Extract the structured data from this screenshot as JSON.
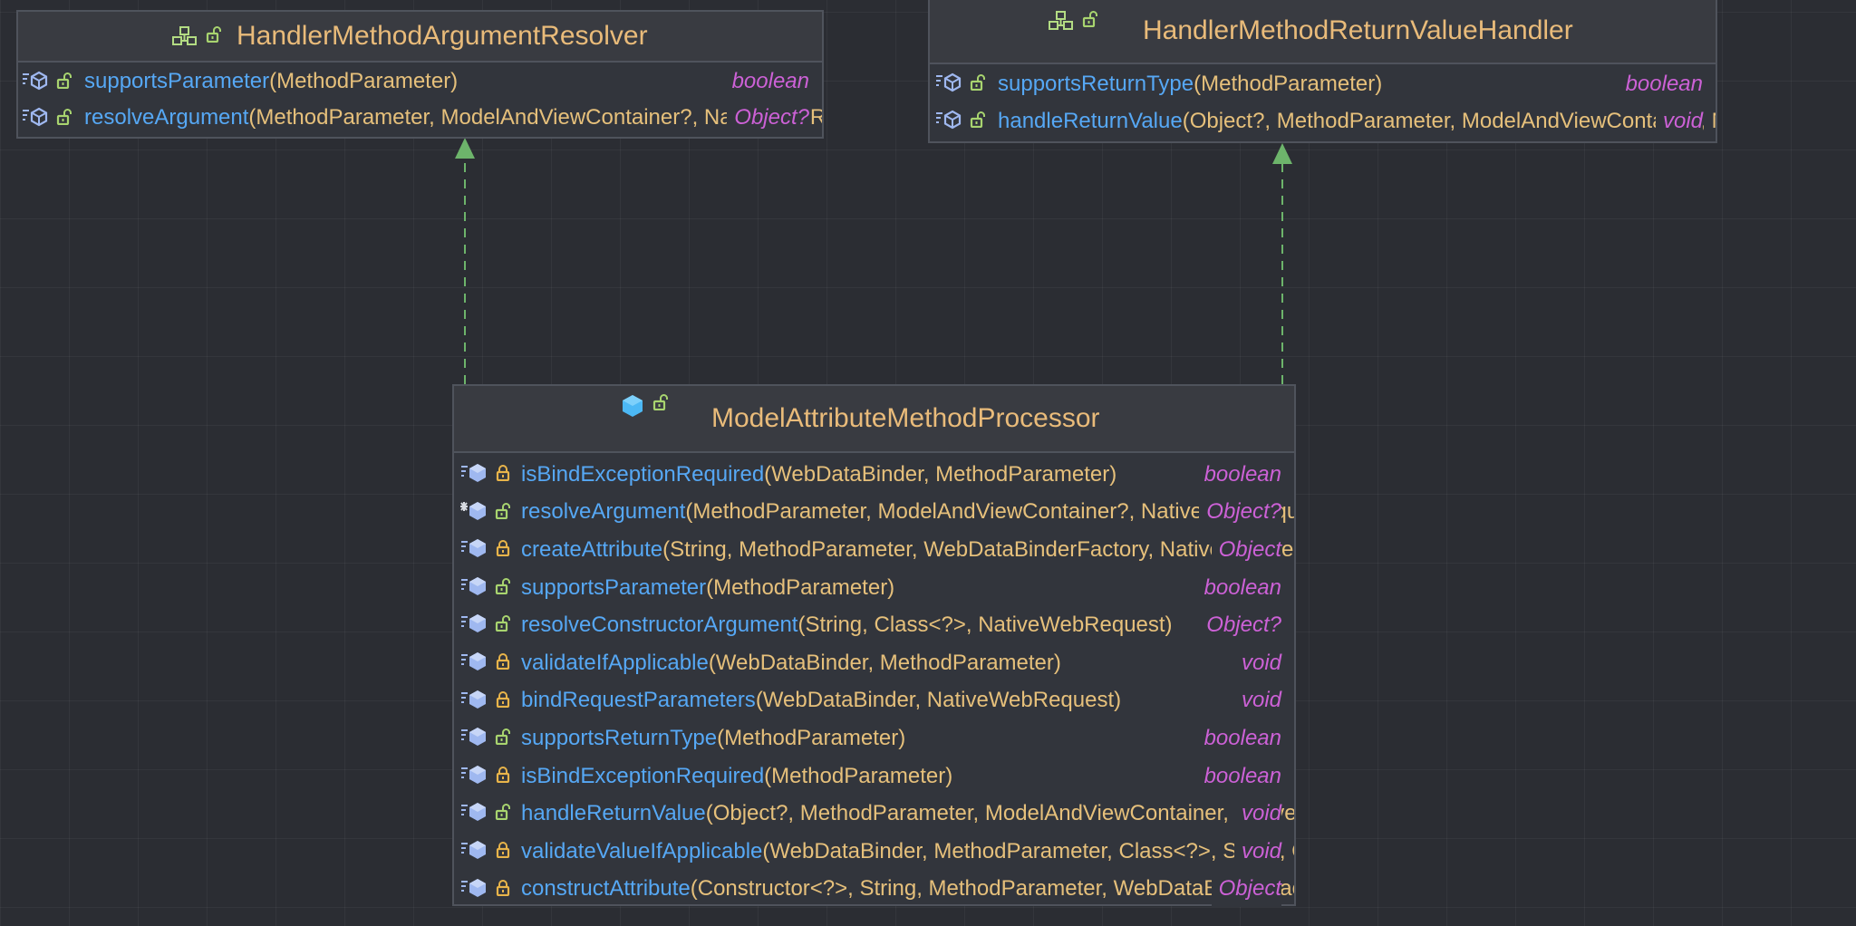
{
  "diagram": {
    "colors": {
      "background": "#2b2d33",
      "node_fill": "#32353c",
      "node_border": "#4f535c",
      "class_name": "#e9bb7a",
      "method_name": "#56a8f5",
      "parameters": "#e6c07b",
      "return_type": "#cc61d6",
      "realization_edge": "#6db46b",
      "interface_icon": "#b3dc83",
      "class_icon": "#4cb8f5",
      "method_icon": "#9fb8f0",
      "public_lock": "#a8d46f",
      "private_lock": "#e8b44a"
    },
    "nodes": {
      "argument_resolver": {
        "kind": "interface",
        "title": "HandlerMethodArgumentResolver",
        "icons": [
          "interface-icon",
          "public-lock-icon"
        ],
        "methods": [
          {
            "name": "supportsParameter",
            "params": "(MethodParameter)",
            "ret": "boolean",
            "icons": [
              "abstract-method-icon",
              "public-lock-icon"
            ]
          },
          {
            "name": "resolveArgument",
            "params": "(MethodParameter, ModelAndViewContainer?, NativeWebRequest?, WebDataBinderFactory?)",
            "ret": "Object?",
            "icons": [
              "abstract-method-icon",
              "public-lock-icon"
            ]
          }
        ]
      },
      "return_value_handler": {
        "kind": "interface",
        "title": "HandlerMethodReturnValueHandler",
        "icons": [
          "interface-icon",
          "public-lock-icon"
        ],
        "methods": [
          {
            "name": "supportsReturnType",
            "params": "(MethodParameter)",
            "ret": "boolean",
            "icons": [
              "abstract-method-icon",
              "public-lock-icon"
            ]
          },
          {
            "name": "handleReturnValue",
            "params": "(Object?, MethodParameter, ModelAndViewContainer, NativeWebRequest)",
            "ret": "void",
            "icons": [
              "abstract-method-icon",
              "public-lock-icon"
            ]
          }
        ]
      },
      "processor": {
        "kind": "class",
        "title": "ModelAttributeMethodProcessor",
        "icons": [
          "class-icon",
          "public-lock-icon"
        ],
        "methods": [
          {
            "name": "isBindExceptionRequired",
            "params": "(WebDataBinder, MethodParameter)",
            "ret": "boolean",
            "icons": [
              "method-icon",
              "protected-lock-icon"
            ]
          },
          {
            "name": "resolveArgument",
            "params": "(MethodParameter, ModelAndViewContainer?, NativeWebRequest, WebDataBinderFactory?)",
            "ret": "Object?",
            "icons": [
              "override-method-icon",
              "public-lock-icon"
            ]
          },
          {
            "name": "createAttribute",
            "params": "(String, MethodParameter, WebDataBinderFactory, NativeWebRequest)",
            "ret": "Object",
            "icons": [
              "method-icon",
              "protected-lock-icon"
            ]
          },
          {
            "name": "supportsParameter",
            "params": "(MethodParameter)",
            "ret": "boolean",
            "icons": [
              "method-icon",
              "public-lock-icon"
            ]
          },
          {
            "name": "resolveConstructorArgument",
            "params": "(String, Class<?>, NativeWebRequest)",
            "ret": "Object?",
            "icons": [
              "method-icon",
              "public-lock-icon"
            ]
          },
          {
            "name": "validateIfApplicable",
            "params": "(WebDataBinder, MethodParameter)",
            "ret": "void",
            "icons": [
              "method-icon",
              "protected-lock-icon"
            ]
          },
          {
            "name": "bindRequestParameters",
            "params": "(WebDataBinder, NativeWebRequest)",
            "ret": "void",
            "icons": [
              "method-icon",
              "protected-lock-icon"
            ]
          },
          {
            "name": "supportsReturnType",
            "params": "(MethodParameter)",
            "ret": "boolean",
            "icons": [
              "method-icon",
              "public-lock-icon"
            ]
          },
          {
            "name": "isBindExceptionRequired",
            "params": "(MethodParameter)",
            "ret": "boolean",
            "icons": [
              "method-icon",
              "protected-lock-icon"
            ]
          },
          {
            "name": "handleReturnValue",
            "params": "(Object?, MethodParameter, ModelAndViewContainer, NativeWebRequest)",
            "ret": "void",
            "icons": [
              "method-icon",
              "public-lock-icon"
            ]
          },
          {
            "name": "validateValueIfApplicable",
            "params": "(WebDataBinder, MethodParameter, Class<?>, String, Object?)",
            "ret": "void",
            "icons": [
              "method-icon",
              "protected-lock-icon"
            ]
          },
          {
            "name": "constructAttribute",
            "params": "(Constructor<?>, String, MethodParameter, WebDataBinderFactory, NativeWebRequest)",
            "ret": "Object",
            "icons": [
              "method-icon",
              "protected-lock-icon"
            ]
          }
        ]
      }
    },
    "edges": [
      {
        "from": "processor",
        "to": "argument_resolver",
        "type": "realization"
      },
      {
        "from": "processor",
        "to": "return_value_handler",
        "type": "realization"
      }
    ]
  }
}
